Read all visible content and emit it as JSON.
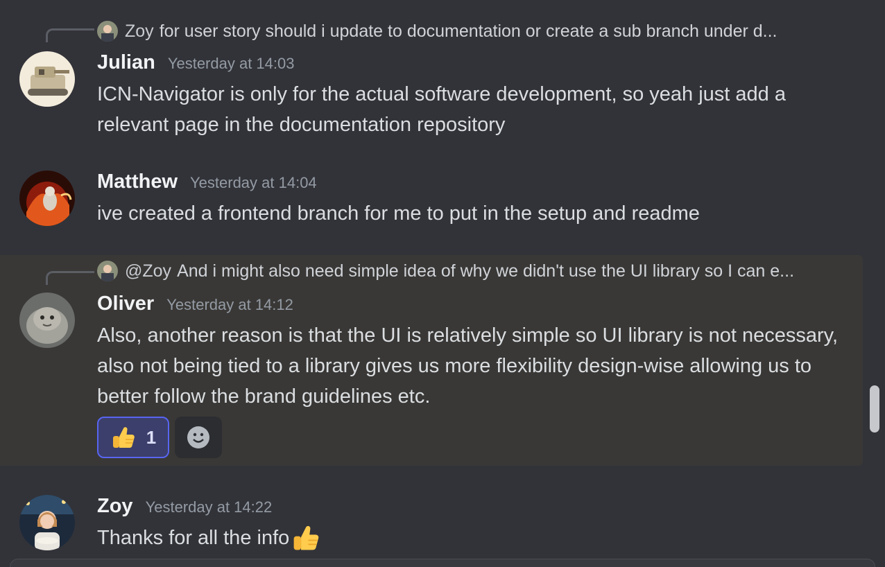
{
  "messages": [
    {
      "author": "Julian",
      "time": "Yesterday at 14:03",
      "reply_to": {
        "name": "Zoy",
        "text": "for user story should i update to documentation or create a sub branch under d..."
      },
      "content": "ICN-Navigator is only for the actual software development, so yeah just add a relevant page in the documentation repository"
    },
    {
      "author": "Matthew",
      "time": "Yesterday at 14:04",
      "content": "ive created a frontend branch for me to put in the setup and readme"
    },
    {
      "author": "Oliver",
      "time": "Yesterday at 14:12",
      "reply_to": {
        "name": "@Zoy",
        "text": "And i might also need simple idea of why we didn't use the UI library so I can e..."
      },
      "content": "Also, another reason is that the UI is relatively simple so UI library is not necessary, also not being tied to a library gives us more flexibility design-wise allowing us to better follow the brand guidelines etc.",
      "reactions": [
        {
          "emoji": "thumbs-up",
          "count": "1"
        }
      ]
    },
    {
      "author": "Zoy",
      "time": "Yesterday at 14:22",
      "content": "Thanks for all the info"
    }
  ],
  "colors": {
    "background": "#323339",
    "highlight": "#393836",
    "accent": "#5865f2",
    "author": "#f2f3f5",
    "timestamp": "#949ba4"
  }
}
